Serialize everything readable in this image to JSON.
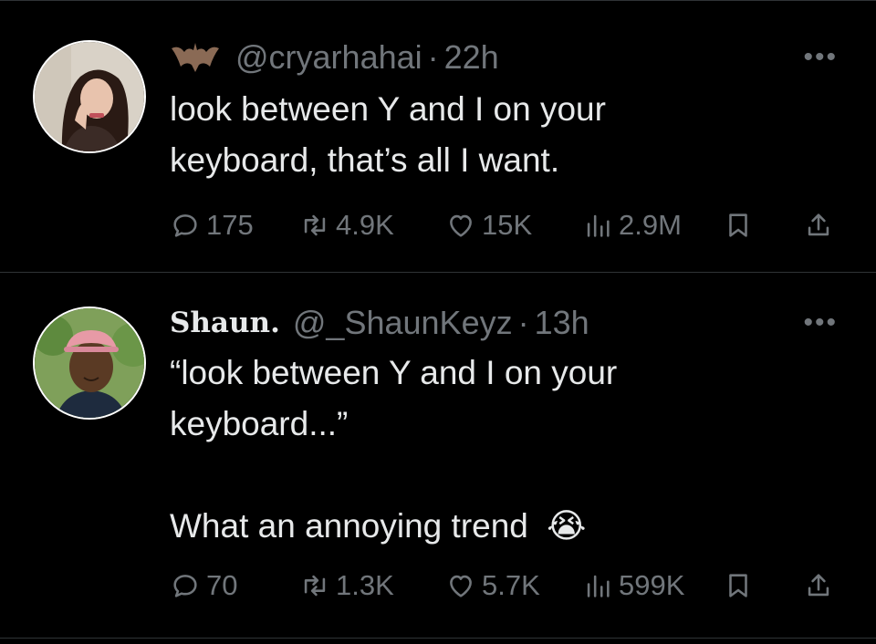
{
  "tweets": [
    {
      "display_name": "",
      "handle": "@cryarhahai",
      "separator": "·",
      "time": "22h",
      "text": "look between Y and I on your\nkeyboard, that’s all I want.",
      "reply_count": "175",
      "repost_count": "4.9K",
      "like_count": "15K",
      "view_count": "2.9M",
      "badge_icon": "bat-icon"
    },
    {
      "display_name": "Shaun.",
      "handle": "@_ShaunKeyz",
      "separator": "·",
      "time": "13h",
      "text": "“look between Y and I on your\nkeyboard...”\n\nWhat an annoying trend",
      "emoji": "😭",
      "reply_count": "70",
      "repost_count": "1.3K",
      "like_count": "5.7K",
      "view_count": "599K"
    }
  ],
  "more_label": "•••",
  "colors": {
    "background": "#000000",
    "text": "#e7e9ea",
    "muted": "#71767b",
    "divider": "#2f3336"
  }
}
